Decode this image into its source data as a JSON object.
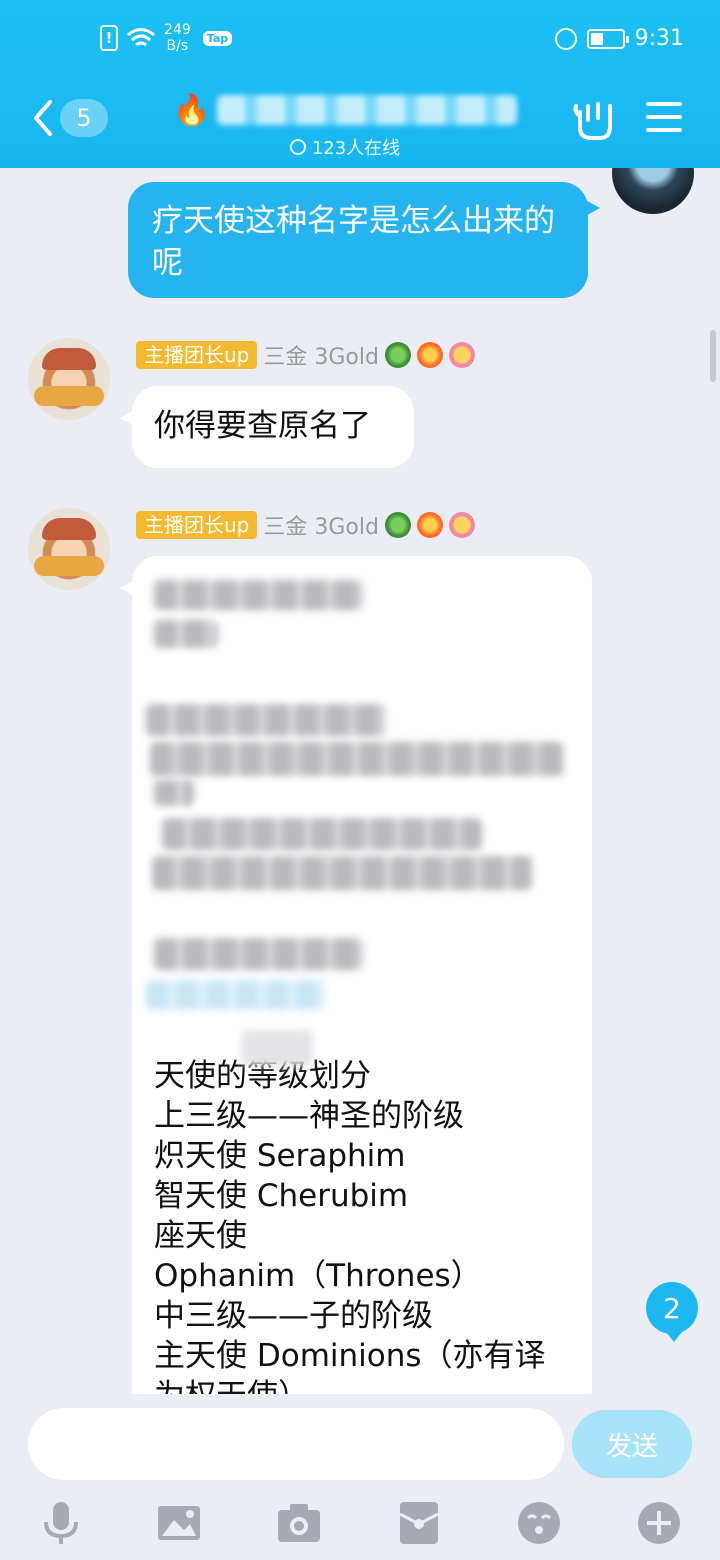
{
  "status_bar": {
    "net_speed_value": "249",
    "net_speed_unit": "B/s",
    "app_badge": "Tap",
    "time": "9:31",
    "battery_level": 0.4
  },
  "header": {
    "back_count": "5",
    "title_emoji": "🔥",
    "online_text": "123人在线",
    "colors": {
      "background": "#1cc0f4"
    }
  },
  "messages": [
    {
      "from": "self",
      "text": "疗天使这种名字是怎么出来的呢"
    },
    {
      "from": "other",
      "role": "主播团长up",
      "name": "三金 3Gold",
      "text": "你得要查原名了"
    },
    {
      "from": "other",
      "role": "主播团长up",
      "name": "三金 3Gold",
      "lines": [
        "天使的等级划分",
        "上三级——神圣的阶级",
        "炽天使 Seraphim",
        "智天使 Cherubim",
        "座天使",
        "Ophanim（Thrones）",
        "中三级——子的阶级",
        "主天使 Dominions（亦有译",
        "为权天使）"
      ]
    }
  ],
  "unread_count": "2",
  "input": {
    "placeholder": "",
    "send_label": "发送"
  },
  "toolbar": [
    "mic-icon",
    "image-icon",
    "camera-icon",
    "gift-icon",
    "emoji-icon",
    "plus-icon"
  ]
}
